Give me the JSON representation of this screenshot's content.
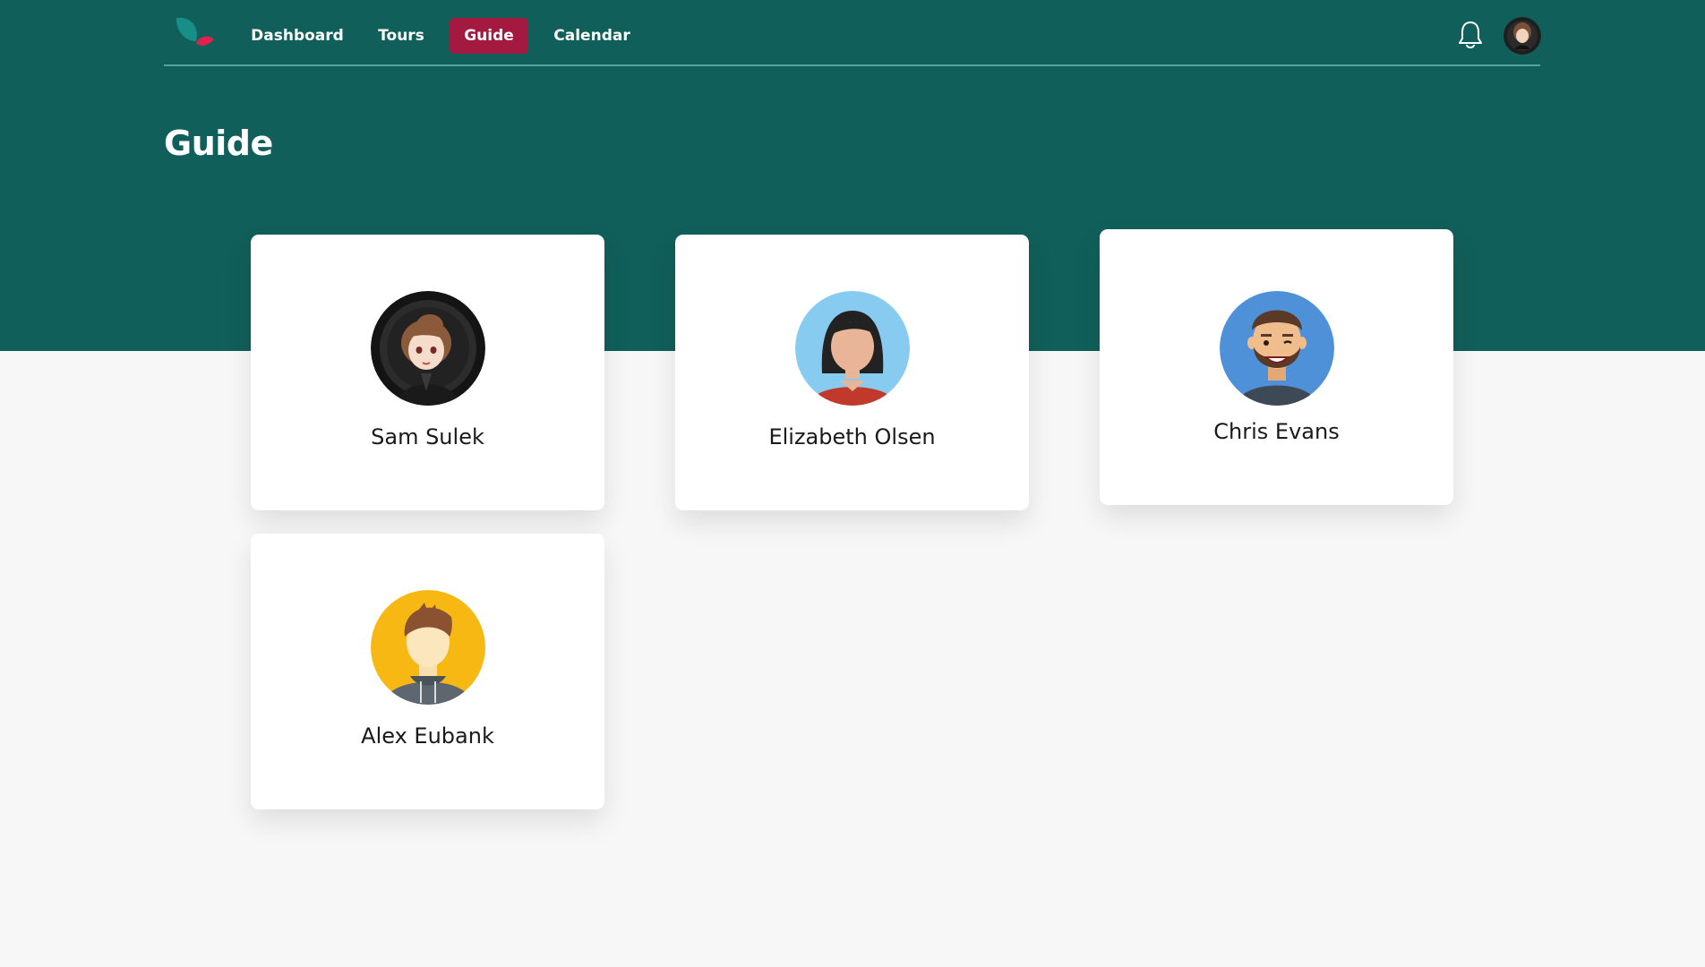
{
  "nav": {
    "logo_icon": "leaf-logo-icon",
    "items": [
      {
        "label": "Dashboard",
        "active": false
      },
      {
        "label": "Tours",
        "active": false
      },
      {
        "label": "Guide",
        "active": true
      },
      {
        "label": "Calendar",
        "active": false
      }
    ],
    "notifications_icon": "bell-icon",
    "profile_icon": "user-avatar-icon"
  },
  "page": {
    "title": "Guide"
  },
  "guides": [
    {
      "name": "Sam Sulek",
      "avatar_icon": "anime-avatar-icon"
    },
    {
      "name": "Elizabeth Olsen",
      "avatar_icon": "woman-avatar-icon"
    },
    {
      "name": "Chris Evans",
      "avatar_icon": "bearded-man-avatar-icon"
    },
    {
      "name": "Alex Eubank",
      "avatar_icon": "hoodie-man-avatar-icon"
    }
  ],
  "colors": {
    "header_bg": "#115f5a",
    "active_nav": "#a3193f",
    "page_bg": "#f7f7f7"
  }
}
